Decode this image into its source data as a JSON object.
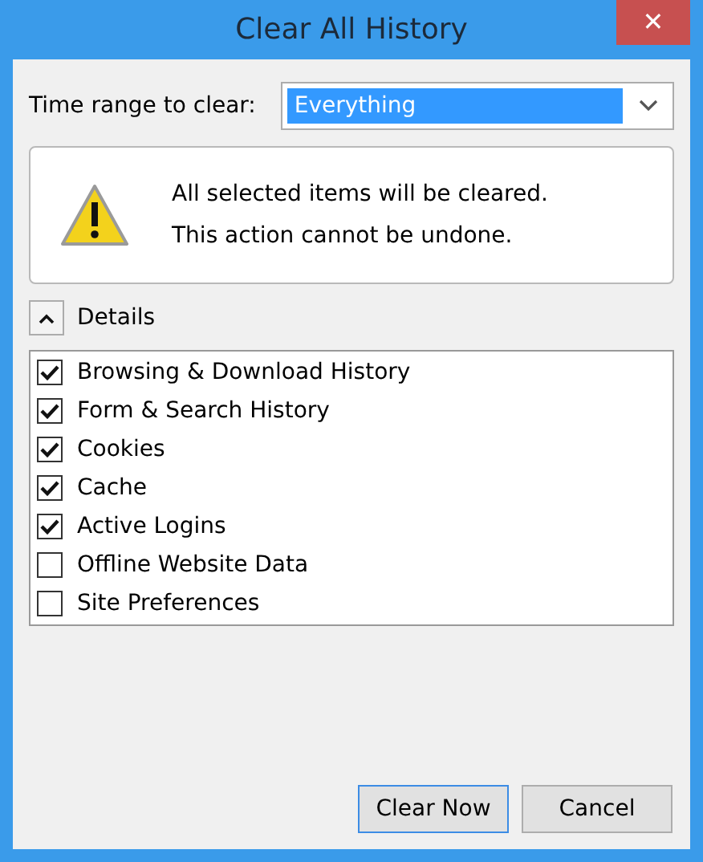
{
  "window": {
    "title": "Clear All History",
    "close": "✕"
  },
  "time_range": {
    "label": "Time range to clear:",
    "value": "Everything"
  },
  "warning": {
    "lines": [
      "All selected items will be cleared.",
      "This action cannot be undone."
    ]
  },
  "details": {
    "label": "Details",
    "expanded": true
  },
  "items": [
    {
      "label": "Browsing & Download History",
      "checked": true
    },
    {
      "label": "Form & Search History",
      "checked": true
    },
    {
      "label": "Cookies",
      "checked": true
    },
    {
      "label": "Cache",
      "checked": true
    },
    {
      "label": "Active Logins",
      "checked": true
    },
    {
      "label": "Offline Website Data",
      "checked": false
    },
    {
      "label": "Site Preferences",
      "checked": false
    }
  ],
  "buttons": [
    {
      "label": "Clear Now",
      "default": true
    },
    {
      "label": "Cancel",
      "default": false
    }
  ]
}
